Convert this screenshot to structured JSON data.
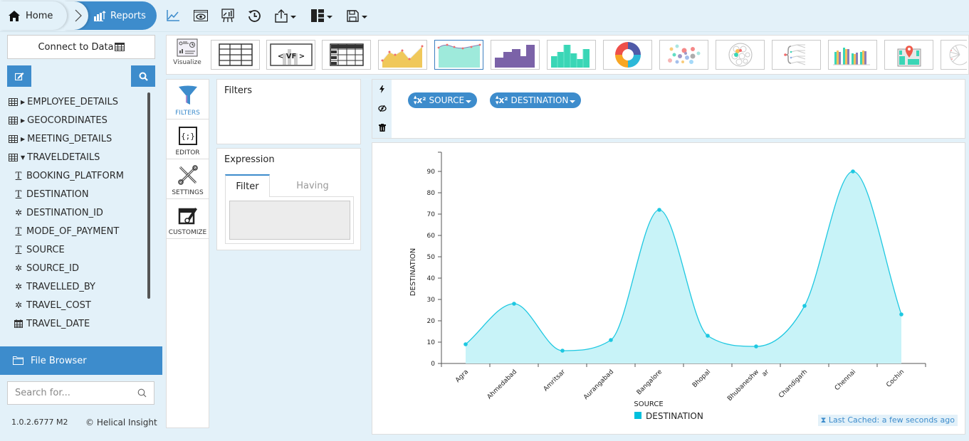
{
  "breadcrumb": {
    "home_label": "Home",
    "reports_label": "Reports"
  },
  "toolbar": {
    "icons": [
      "line-chart-icon",
      "preview-icon",
      "presentation-icon",
      "history-icon",
      "share-icon",
      "layout-icon",
      "save-icon"
    ]
  },
  "sidebar": {
    "connect_label": "Connect to Data",
    "tables": [
      {
        "name": "EMPLOYEE_DETAILS",
        "expanded": false
      },
      {
        "name": "GEOCORDINATES",
        "expanded": false
      },
      {
        "name": "MEETING_DETAILS",
        "expanded": false
      },
      {
        "name": "TRAVELDETAILS",
        "expanded": true
      }
    ],
    "fields": [
      {
        "name": "BOOKING_PLATFORM",
        "type": "text"
      },
      {
        "name": "DESTINATION",
        "type": "text"
      },
      {
        "name": "DESTINATION_ID",
        "type": "numeric"
      },
      {
        "name": "MODE_OF_PAYMENT",
        "type": "text"
      },
      {
        "name": "SOURCE",
        "type": "text"
      },
      {
        "name": "SOURCE_ID",
        "type": "numeric"
      },
      {
        "name": "TRAVELLED_BY",
        "type": "numeric"
      },
      {
        "name": "TRAVEL_COST",
        "type": "numeric"
      },
      {
        "name": "TRAVEL_DATE",
        "type": "date"
      }
    ],
    "file_browser_label": "File Browser",
    "search_placeholder": "Search for...",
    "version": "1.0.2.6777 M2",
    "copyright": "© Helical Insight"
  },
  "vizbar": {
    "visualize_label": "Visualize",
    "types": [
      "table",
      "vf",
      "crosstab",
      "area",
      "spline-area",
      "step",
      "bar",
      "donut",
      "scatter",
      "bubble-pack",
      "tree",
      "grouped-bar",
      "map",
      "radial"
    ],
    "active": "spline-area"
  },
  "side_tabs": [
    {
      "label": "FILTERS",
      "active": true
    },
    {
      "label": "EDITOR",
      "active": false
    },
    {
      "label": "SETTINGS",
      "active": false
    },
    {
      "label": "CUSTOMIZE",
      "active": false
    }
  ],
  "filters_panel": {
    "title": "Filters"
  },
  "expression_panel": {
    "title": "Expression",
    "tabs": [
      "Filter",
      "Having"
    ],
    "active_tab": "Filter",
    "value": ""
  },
  "fields_panel": {
    "pills": [
      {
        "label": "SOURCE"
      },
      {
        "label": "DESTINATION"
      }
    ]
  },
  "chart_status": {
    "last_cached": "Last Cached: a few seconds ago"
  },
  "colors": {
    "accent": "#3d8ccc",
    "series_line": "#1ec8e1",
    "series_fill": "#c8f3f8",
    "legend_swatch": "#00c0dd"
  },
  "chart_data": {
    "type": "area",
    "title": "",
    "xlabel": "SOURCE",
    "ylabel": "DESTINATION",
    "categories": [
      "Agra",
      "Ahmedabad",
      "Amritsar",
      "Aurangabad",
      "Bangalore",
      "Bhopal",
      "Bhubaneshwar",
      "Chandigarh",
      "Chennai",
      "Cochin"
    ],
    "category_labels": [
      "Agra",
      "Ahmedabad",
      "Amritsar",
      "Aurangabad",
      "Bangalore",
      "Bhopal",
      "Bhubaneshw ar",
      "Chandigarh",
      "Chennai",
      "Cochin"
    ],
    "series": [
      {
        "name": "DESTINATION",
        "values": [
          9,
          28,
          6,
          11,
          72,
          13,
          8,
          27,
          90,
          23
        ]
      }
    ],
    "ylim": [
      0,
      99
    ],
    "yticks": [
      0,
      10,
      20,
      30,
      40,
      50,
      60,
      70,
      80,
      90
    ],
    "interpolation": "spline",
    "grid": false,
    "legend": "bottom-center"
  }
}
